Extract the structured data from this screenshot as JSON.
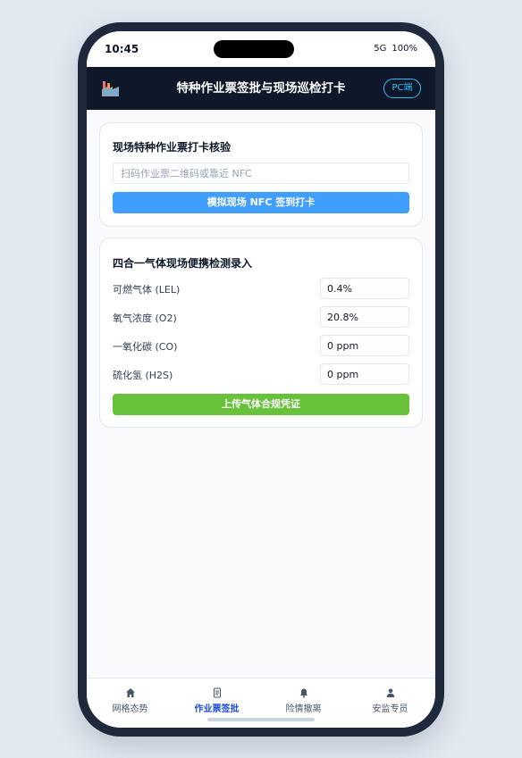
{
  "status_bar": {
    "time": "10:45",
    "network": "5G",
    "battery": "100%"
  },
  "header": {
    "logo_icon": "factory-icon",
    "title": "特种作业票签批与现场巡检打卡",
    "pc_button": "PC端"
  },
  "checkin_card": {
    "title": "现场特种作业票打卡核验",
    "scan_input": {
      "value": "",
      "placeholder": "扫码作业票二维码或靠近 NFC"
    },
    "nfc_button": "模拟现场 NFC 签到打卡"
  },
  "gas_card": {
    "title": "四合一气体现场便携检测录入",
    "fields": [
      {
        "label": "可燃气体 (LEL)",
        "value": "0.4%"
      },
      {
        "label": "氧气浓度 (O2)",
        "value": "20.8%"
      },
      {
        "label": "一氧化碳 (CO)",
        "value": "0 ppm"
      },
      {
        "label": "硫化氢 (H2S)",
        "value": "0 ppm"
      }
    ],
    "submit_button": "上传气体合规凭证"
  },
  "tabbar": {
    "tabs": [
      {
        "label": "网格态势",
        "icon": "home-icon"
      },
      {
        "label": "作业票签批",
        "icon": "document-icon",
        "active": true
      },
      {
        "label": "险情撤离",
        "icon": "bell-icon"
      },
      {
        "label": "安监专员",
        "icon": "user-icon"
      }
    ]
  },
  "colors": {
    "header_bg": "#0f172a",
    "primary_blue": "#409eff",
    "success_green": "#67c23a",
    "active_tab": "#1d4ed8",
    "pc_accent": "#38bdf8"
  }
}
